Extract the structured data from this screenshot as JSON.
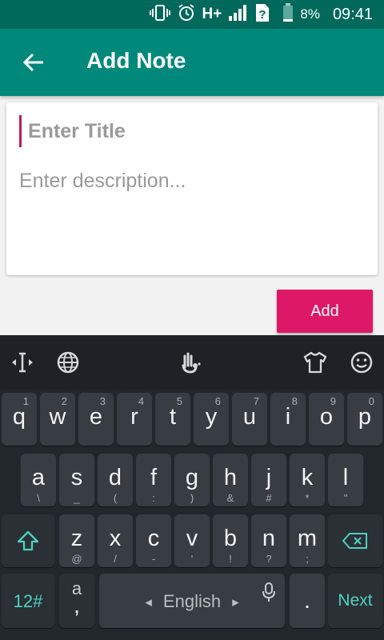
{
  "status_bar": {
    "network": "H+",
    "battery": "8%",
    "time": "09:41"
  },
  "app_bar": {
    "title": "Add Note"
  },
  "form": {
    "title_placeholder": "Enter Title",
    "description_placeholder": "Enter description...",
    "add_label": "Add"
  },
  "colors": {
    "status_bar": "#00695c",
    "app_bar": "#00897b",
    "accent": "#dd1866",
    "keyboard_bg": "#22272b",
    "key_bg": "#373d42",
    "teal_key_text": "#4dd0c4"
  },
  "keyboard": {
    "toolbar_icons": [
      "text-cursor-icon",
      "globe-icon",
      "gesture-icon",
      "theme-shirt-icon",
      "emoji-icon"
    ],
    "row1": [
      {
        "k": "q",
        "h": "1"
      },
      {
        "k": "w",
        "h": "2"
      },
      {
        "k": "e",
        "h": "3"
      },
      {
        "k": "r",
        "h": "4"
      },
      {
        "k": "t",
        "h": "5"
      },
      {
        "k": "y",
        "h": "6"
      },
      {
        "k": "u",
        "h": "7"
      },
      {
        "k": "i",
        "h": "8"
      },
      {
        "k": "o",
        "h": "9"
      },
      {
        "k": "p",
        "h": "0"
      }
    ],
    "row2": [
      {
        "k": "a",
        "h": "\\"
      },
      {
        "k": "s",
        "h": "_"
      },
      {
        "k": "d",
        "h": "("
      },
      {
        "k": "f",
        "h": ":"
      },
      {
        "k": "g",
        "h": ")"
      },
      {
        "k": "h",
        "h": "&"
      },
      {
        "k": "j",
        "h": "#"
      },
      {
        "k": "k",
        "h": "*"
      },
      {
        "k": "l",
        "h": "\""
      }
    ],
    "row3": [
      {
        "k": "z",
        "h": "@"
      },
      {
        "k": "x",
        "h": "/"
      },
      {
        "k": "c",
        "h": "-"
      },
      {
        "k": "v",
        "h": "'"
      },
      {
        "k": "b",
        "h": "!"
      },
      {
        "k": "n",
        "h": "?"
      },
      {
        "k": "m",
        "h": ";"
      }
    ],
    "numbers_label": "12#",
    "punct_key": {
      "top": "a",
      "bottom": ","
    },
    "space_label": "English",
    "period": ".",
    "next_label": "Next"
  }
}
